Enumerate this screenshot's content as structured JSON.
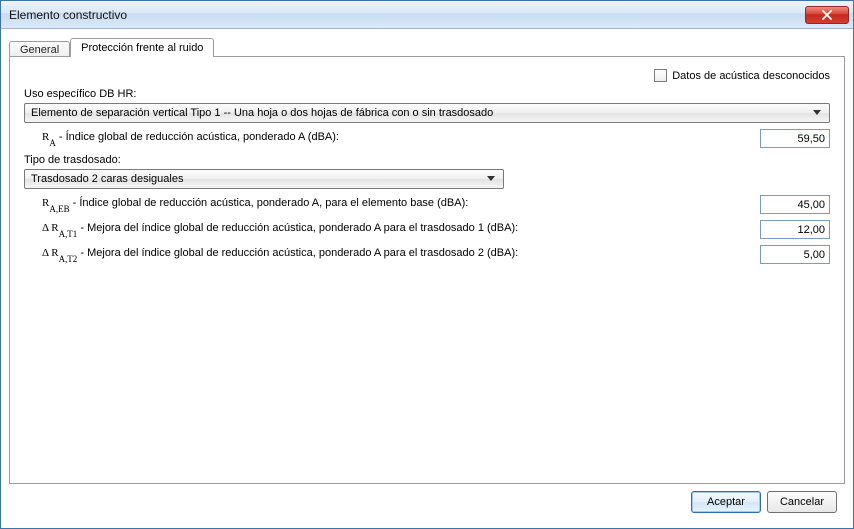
{
  "window": {
    "title": "Elemento constructivo"
  },
  "tabs": {
    "general": "General",
    "noise": "Protección frente al ruido"
  },
  "panel": {
    "unknown_acoustic_label": "Datos de acústica desconocidos",
    "unknown_acoustic_checked": false,
    "db_hr_label": "Uso específico DB HR:",
    "db_hr_value": "Elemento de separación vertical Tipo 1 -- Una hoja o dos hojas de fábrica con o sin trasdosado",
    "ra_label_prefix": "R",
    "ra_sub": "A",
    "ra_desc": " - Índice global de reducción acústica, ponderado A (dBA):",
    "ra_value": "59,50",
    "trasdosado_type_label": "Tipo de trasdosado:",
    "trasdosado_type_value": "Trasdosado 2 caras desiguales",
    "raeb_prefix": "R",
    "raeb_sub": "A,EB",
    "raeb_desc": " - Índice global de reducción acústica, ponderado A, para el elemento base (dBA):",
    "raeb_value": "45,00",
    "delta": "Δ",
    "rat1_prefix": " R",
    "rat1_sub": "A,T1",
    "rat1_desc": "  - Mejora del índice global de reducción acústica, ponderado A para el trasdosado 1 (dBA):",
    "rat1_value": "12,00",
    "rat2_prefix": " R",
    "rat2_sub": "A,T2",
    "rat2_desc": "  - Mejora del índice global de reducción acústica, ponderado A para el trasdosado 2 (dBA):",
    "rat2_value": "5,00"
  },
  "footer": {
    "accept": "Aceptar",
    "cancel": "Cancelar"
  }
}
